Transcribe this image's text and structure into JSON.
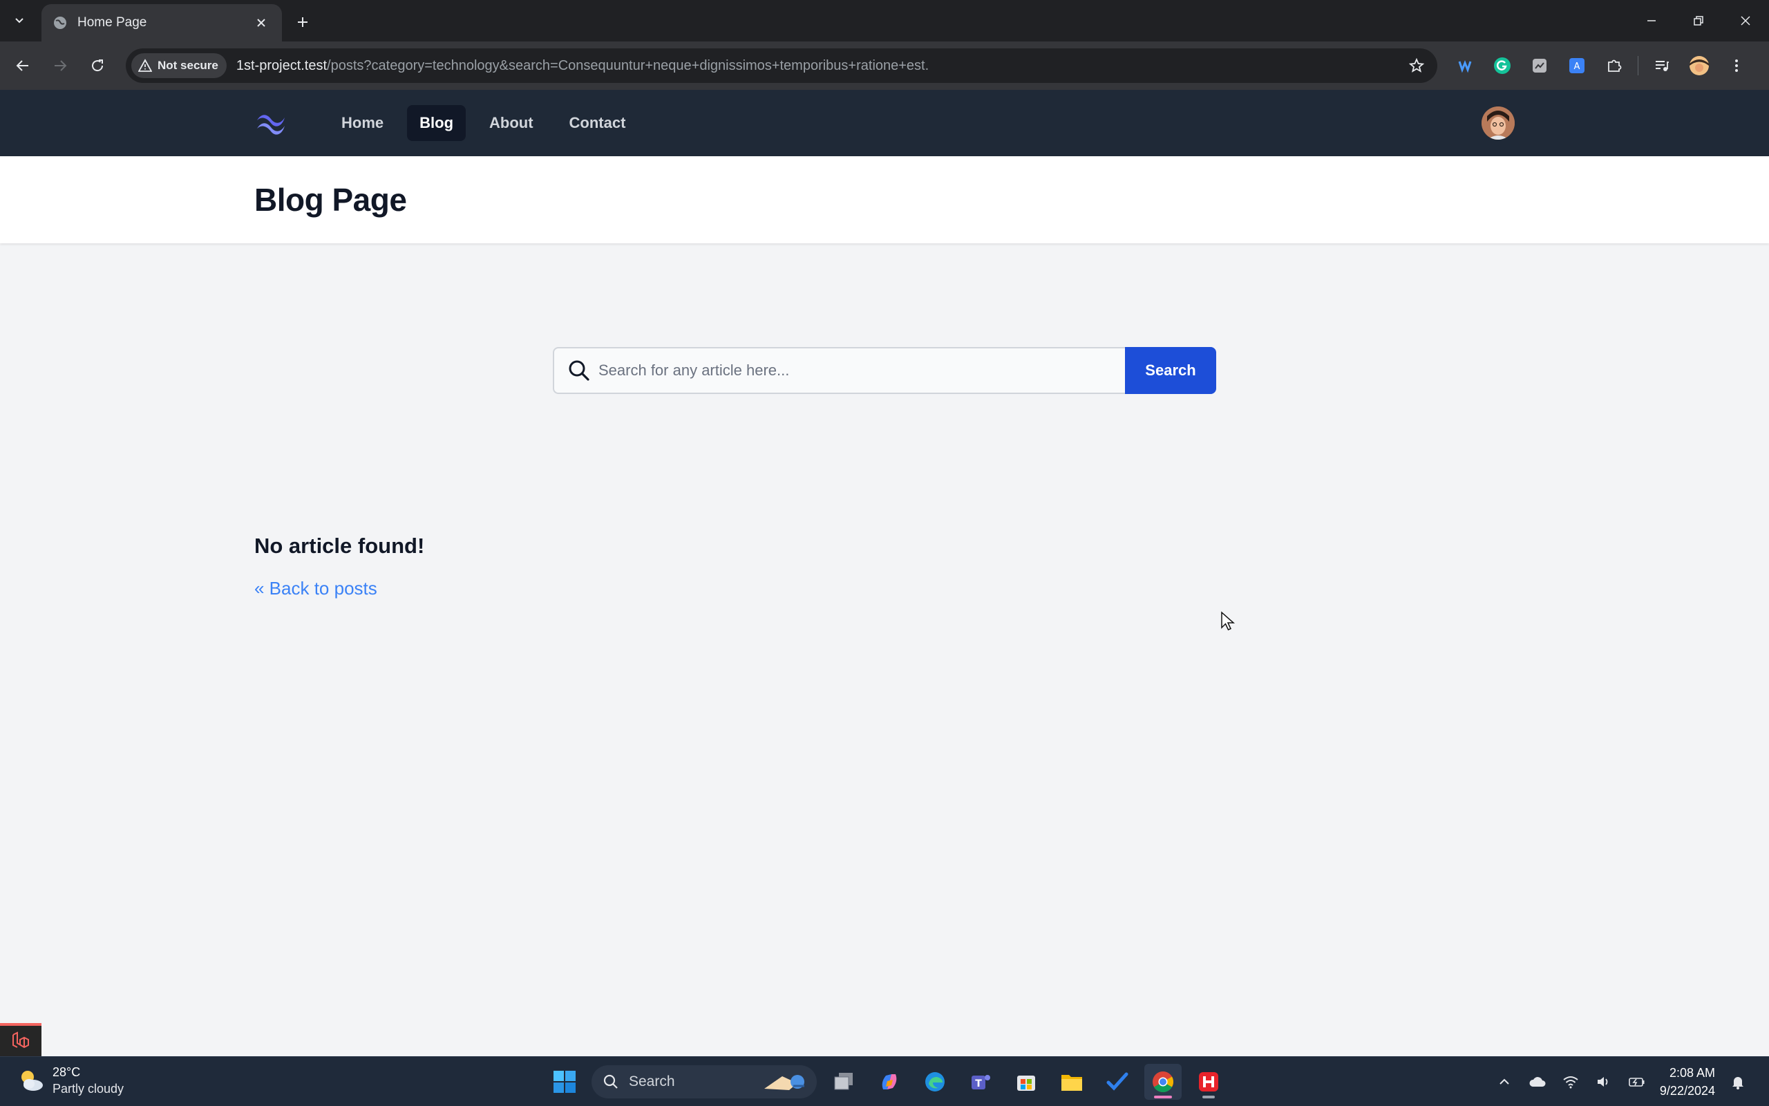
{
  "browser": {
    "tab_title": "Home Page",
    "security_label": "Not secure",
    "url_host": "1st-project.test",
    "url_path": "/posts?category=technology&search=Consequuntur+neque+dignissimos+temporibus+ratione+est."
  },
  "site": {
    "nav": {
      "home": "Home",
      "blog": "Blog",
      "about": "About",
      "contact": "Contact",
      "active": "Blog"
    },
    "page_title": "Blog Page",
    "search": {
      "placeholder": "Search for any article here...",
      "button_label": "Search"
    },
    "empty_message": "No article found!",
    "back_link": "« Back to posts",
    "accent_color": "#1d4ed8",
    "link_color": "#3b82f6"
  },
  "taskbar": {
    "weather_temp": "28°C",
    "weather_desc": "Partly cloudy",
    "search_label": "Search",
    "time": "2:08 AM",
    "date": "9/22/2024",
    "apps": [
      "windows-start-icon",
      "task-view-icon",
      "copilot-icon",
      "edge-icon",
      "teams-icon",
      "store-icon",
      "file-explorer-icon",
      "todo-icon",
      "chrome-icon",
      "herd-icon"
    ]
  }
}
